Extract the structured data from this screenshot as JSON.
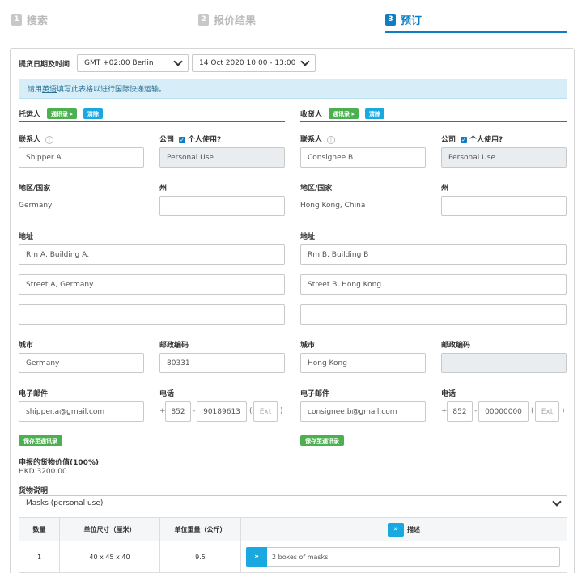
{
  "steps": [
    {
      "num": "1",
      "label": "搜索"
    },
    {
      "num": "2",
      "label": "报价结果"
    },
    {
      "num": "3",
      "label": "预订"
    }
  ],
  "pickup": {
    "label": "提货日期及时间",
    "timezone": "GMT +02:00 Berlin",
    "datetime": "14 Oct 2020 10:00 - 13:00"
  },
  "notice": {
    "before": "请用",
    "link": "英语",
    "after": "填写此表格以进行国际快递运输。"
  },
  "shipper": {
    "title": "托运人",
    "address_book_btn": "通讯录 ▸",
    "clear_btn": "清除",
    "contact_label": "联系人",
    "contact_value": "Shipper A",
    "company_label": "公司",
    "personal_label": "个人使用?",
    "company_value": "Personal Use",
    "region_label": "地区/国家",
    "region_value": "Germany",
    "state_label": "州",
    "state_value": "",
    "address_label": "地址",
    "address1": "Rm A, Building A,",
    "address2": "Street A, Germany",
    "address3": "",
    "city_label": "城市",
    "city_value": "Germany",
    "postal_label": "邮政编码",
    "postal_value": "80331",
    "email_label": "电子邮件",
    "email_value": "shipper.a@gmail.com",
    "phone_label": "电话",
    "phone_plus": "+",
    "phone_code": "852",
    "phone_dash": "-",
    "phone_number": "90189613",
    "ext_open": "(",
    "ext_placeholder": "Ext",
    "ext_close": ")",
    "save_btn": "保存至通讯录"
  },
  "consignee": {
    "title": "收货人",
    "address_book_btn": "通讯录 ▸",
    "clear_btn": "清除",
    "contact_label": "联系人",
    "contact_value": "Consignee B",
    "company_label": "公司",
    "personal_label": "个人使用?",
    "company_value": "Personal Use",
    "region_label": "地区/国家",
    "region_value": "Hong Kong, China",
    "state_label": "州",
    "state_value": "",
    "address_label": "地址",
    "address1": "Rm B, Building B",
    "address2": "Street B, Hong Kong",
    "address3": "",
    "city_label": "城市",
    "city_value": "Hong Kong",
    "postal_label": "邮政编码",
    "postal_value": "",
    "email_label": "电子邮件",
    "email_value": "consignee.b@gmail.com",
    "phone_label": "电话",
    "phone_plus": "+",
    "phone_code": "852",
    "phone_dash": "-",
    "phone_number": "00000000",
    "ext_open": "(",
    "ext_placeholder": "Ext",
    "ext_close": ")",
    "save_btn": "保存至通讯录"
  },
  "declared": {
    "label": "申报的货物价值(100%)",
    "value": "HKD 3200.00"
  },
  "goods": {
    "label": "货物说明",
    "value": "Masks (personal use)"
  },
  "table": {
    "headers": [
      "数量",
      "单位尺寸（厘米）",
      "单位重量（公斤）",
      "描述"
    ],
    "rows": [
      {
        "qty": "1",
        "size": "40 x 45 x 40",
        "weight": "9.5",
        "desc": "2 boxes of masks"
      }
    ]
  },
  "colors": {
    "accent": "#0f7dc2",
    "green": "#4caf50",
    "button_blue": "#19a8e0",
    "notice_bg": "#d7eef8"
  }
}
